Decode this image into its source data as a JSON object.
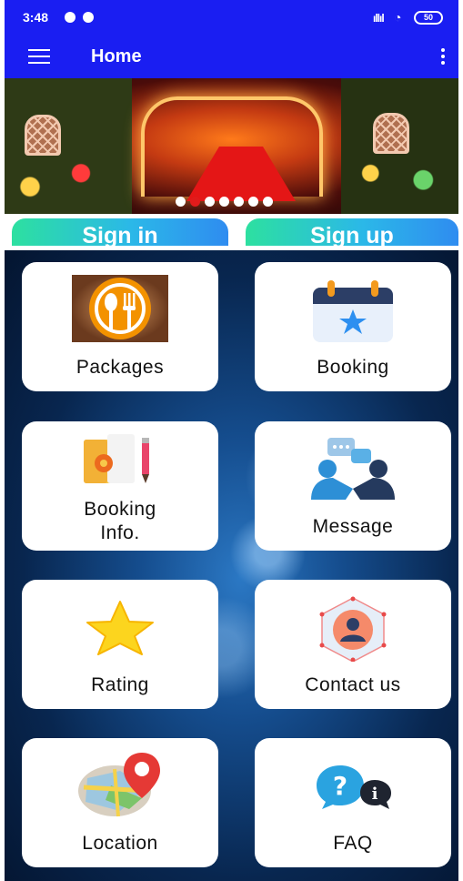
{
  "status_bar": {
    "time": "3:48",
    "battery": "50"
  },
  "app_bar": {
    "title": "Home"
  },
  "banner": {
    "slide_count": 7,
    "active_slide": 2
  },
  "auth": {
    "sign_in_label": "Sign in",
    "sign_up_label": "Sign up"
  },
  "menu": {
    "items": [
      {
        "label": "Packages",
        "icon": "restaurant-icon"
      },
      {
        "label": "Booking",
        "icon": "calendar-star-icon"
      },
      {
        "label": "Booking\nInfo.",
        "icon": "document-gear-icon"
      },
      {
        "label": "Message",
        "icon": "chat-people-icon"
      },
      {
        "label": "Rating",
        "icon": "star-icon"
      },
      {
        "label": "Contact us",
        "icon": "contact-person-icon"
      },
      {
        "label": "Location",
        "icon": "map-pin-icon"
      },
      {
        "label": "FAQ",
        "icon": "faq-bubble-icon"
      }
    ]
  },
  "colors": {
    "primary": "#1a1ef2",
    "auth_gradient_start": "#2de0a0",
    "auth_gradient_end": "#2f8cf0",
    "active_dot": "#e01b1b"
  }
}
